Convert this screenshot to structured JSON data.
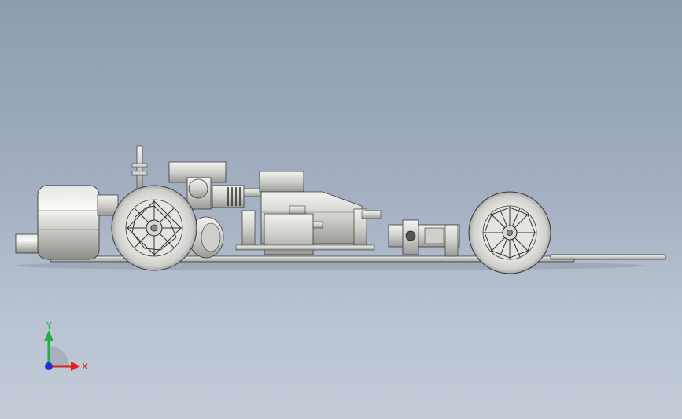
{
  "viewport": {
    "background_top": "#8e9cb0",
    "background_bottom": "#c4ccd8"
  },
  "model": {
    "part_color": "#d9d9d6",
    "edge_color": "#3a3a3a"
  },
  "triad": {
    "x_label": "X",
    "y_label": "Y",
    "x_color": "#e02020",
    "y_color": "#20b040",
    "z_color": "#2030d0"
  }
}
